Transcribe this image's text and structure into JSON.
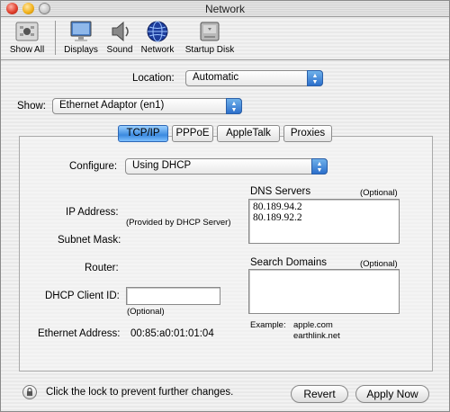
{
  "window": {
    "title": "Network"
  },
  "toolbar": {
    "items": [
      {
        "label": "Show All",
        "icon": "apple-grid-icon"
      },
      {
        "label": "Displays",
        "icon": "monitor-icon"
      },
      {
        "label": "Sound",
        "icon": "speaker-icon"
      },
      {
        "label": "Network",
        "icon": "globe-icon"
      },
      {
        "label": "Startup Disk",
        "icon": "disk-icon"
      }
    ]
  },
  "location": {
    "label": "Location:",
    "value": "Automatic"
  },
  "show": {
    "label": "Show:",
    "value": "Ethernet Adaptor (en1)"
  },
  "tabs": [
    "TCP/IP",
    "PPPoE",
    "AppleTalk",
    "Proxies"
  ],
  "tcpip": {
    "configure_label": "Configure:",
    "configure_value": "Using DHCP",
    "ip_label": "IP Address:",
    "ip_note": "(Provided by DHCP Server)",
    "subnet_label": "Subnet Mask:",
    "router_label": "Router:",
    "dhcp_client_label": "DHCP Client ID:",
    "dhcp_client_value": "",
    "dhcp_client_note": "(Optional)",
    "ethernet_label": "Ethernet Address:",
    "ethernet_value": "00:85:a0:01:01:04",
    "dns_label": "DNS Servers",
    "dns_optional": "(Optional)",
    "dns_values": [
      "80.189.94.2",
      "80.189.92.2"
    ],
    "search_label": "Search Domains",
    "search_optional": "(Optional)",
    "example_label": "Example:",
    "example_values": [
      "apple.com",
      "earthlink.net"
    ]
  },
  "footer": {
    "lock_text": "Click the lock to prevent further changes.",
    "revert_label": "Revert",
    "apply_label": "Apply Now"
  },
  "colors": {
    "accent": "#3c8ae0",
    "close": "#e0402d",
    "minimize": "#f2b21c"
  }
}
